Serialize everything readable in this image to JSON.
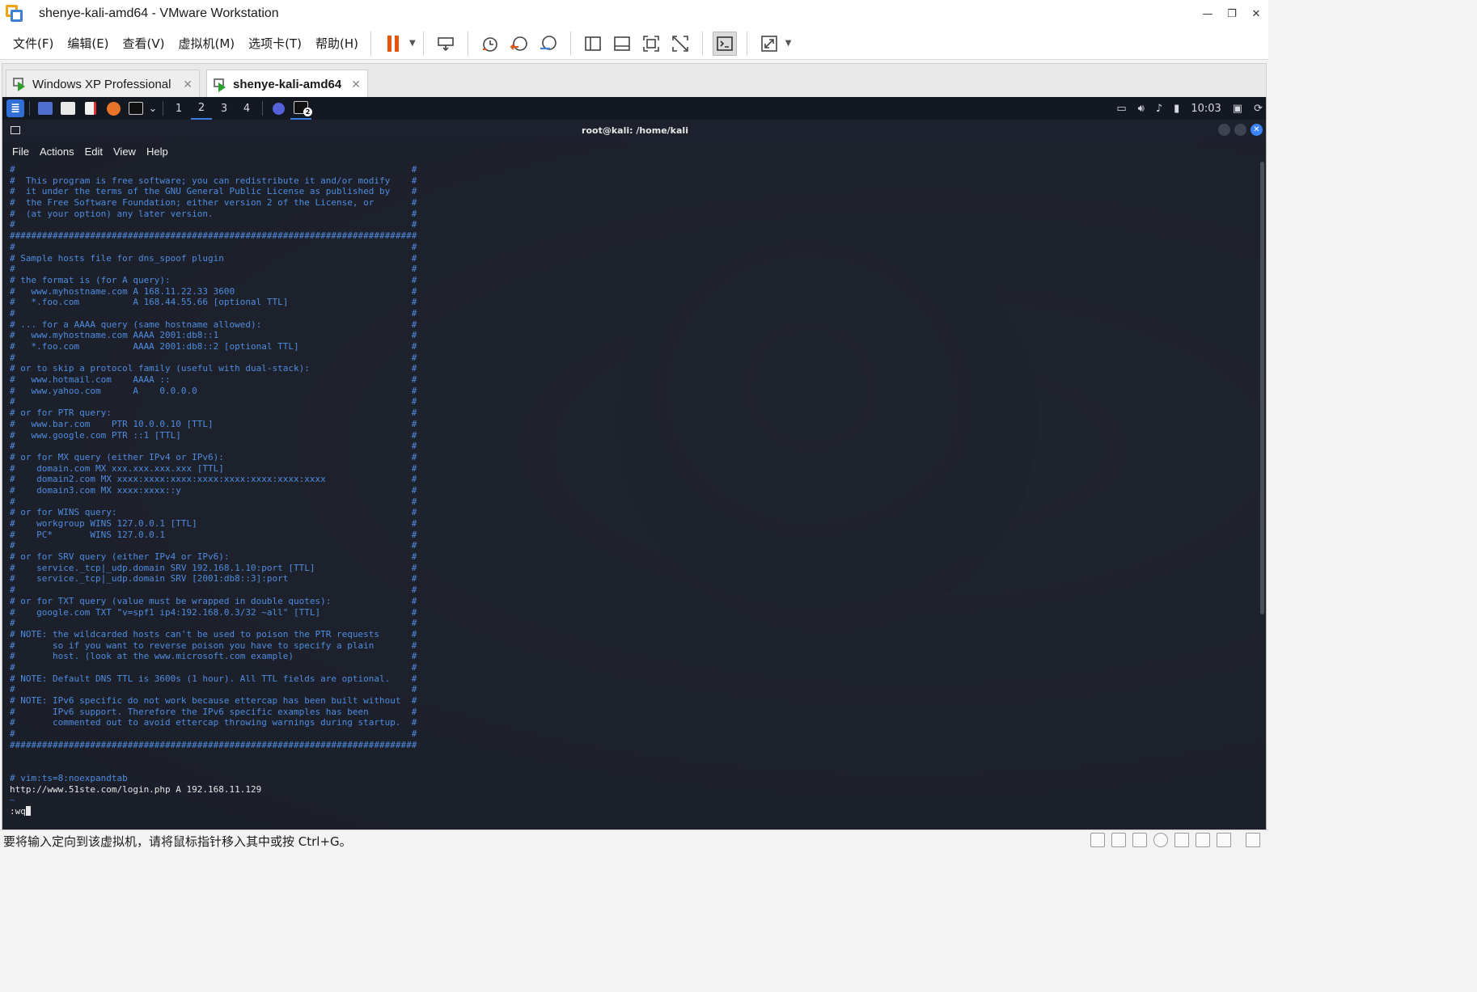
{
  "window": {
    "title": "shenye-kali-amd64 - VMware Workstation"
  },
  "menu": [
    "文件(F)",
    "编辑(E)",
    "查看(V)",
    "虚拟机(M)",
    "选项卡(T)",
    "帮助(H)"
  ],
  "tabs": [
    {
      "label": "Windows XP Professional",
      "active": false
    },
    {
      "label": "shenye-kali-amd64",
      "active": true
    }
  ],
  "guest_panel": {
    "workspaces": [
      "1",
      "2",
      "3",
      "4"
    ],
    "current_workspace": "2",
    "clock": "10:03",
    "terminal_badge": "2"
  },
  "terminal": {
    "title": "root@kali: /home/kali",
    "menu": [
      "File",
      "Actions",
      "Edit",
      "View",
      "Help"
    ],
    "lines": [
      {
        "t": "#                                                                          #",
        "c": "comment"
      },
      {
        "t": "#  This program is free software; you can redistribute it and/or modify    #",
        "c": "comment"
      },
      {
        "t": "#  it under the terms of the GNU General Public License as published by    #",
        "c": "comment"
      },
      {
        "t": "#  the Free Software Foundation; either version 2 of the License, or       #",
        "c": "comment"
      },
      {
        "t": "#  (at your option) any later version.                                     #",
        "c": "comment"
      },
      {
        "t": "#                                                                          #",
        "c": "comment"
      },
      {
        "t": "############################################################################",
        "c": "comment"
      },
      {
        "t": "#                                                                          #",
        "c": "comment"
      },
      {
        "t": "# Sample hosts file for dns_spoof plugin                                   #",
        "c": "comment"
      },
      {
        "t": "#                                                                          #",
        "c": "comment"
      },
      {
        "t": "# the format is (for A query):                                             #",
        "c": "comment"
      },
      {
        "t": "#   www.myhostname.com A 168.11.22.33 3600                                 #",
        "c": "comment"
      },
      {
        "t": "#   *.foo.com          A 168.44.55.66 [optional TTL]                       #",
        "c": "comment"
      },
      {
        "t": "#                                                                          #",
        "c": "comment"
      },
      {
        "t": "# ... for a AAAA query (same hostname allowed):                            #",
        "c": "comment"
      },
      {
        "t": "#   www.myhostname.com AAAA 2001:db8::1                                    #",
        "c": "comment"
      },
      {
        "t": "#   *.foo.com          AAAA 2001:db8::2 [optional TTL]                     #",
        "c": "comment"
      },
      {
        "t": "#                                                                          #",
        "c": "comment"
      },
      {
        "t": "# or to skip a protocol family (useful with dual-stack):                   #",
        "c": "comment"
      },
      {
        "t": "#   www.hotmail.com    AAAA ::                                             #",
        "c": "comment"
      },
      {
        "t": "#   www.yahoo.com      A    0.0.0.0                                        #",
        "c": "comment"
      },
      {
        "t": "#                                                                          #",
        "c": "comment"
      },
      {
        "t": "# or for PTR query:                                                        #",
        "c": "comment"
      },
      {
        "t": "#   www.bar.com    PTR 10.0.0.10 [TTL]                                     #",
        "c": "comment"
      },
      {
        "t": "#   www.google.com PTR ::1 [TTL]                                           #",
        "c": "comment"
      },
      {
        "t": "#                                                                          #",
        "c": "comment"
      },
      {
        "t": "# or for MX query (either IPv4 or IPv6):                                   #",
        "c": "comment"
      },
      {
        "t": "#    domain.com MX xxx.xxx.xxx.xxx [TTL]                                   #",
        "c": "comment"
      },
      {
        "t": "#    domain2.com MX xxxx:xxxx:xxxx:xxxx:xxxx:xxxx:xxxx:xxxx                #",
        "c": "comment"
      },
      {
        "t": "#    domain3.com MX xxxx:xxxx::y                                           #",
        "c": "comment"
      },
      {
        "t": "#                                                                          #",
        "c": "comment"
      },
      {
        "t": "# or for WINS query:                                                       #",
        "c": "comment"
      },
      {
        "t": "#    workgroup WINS 127.0.0.1 [TTL]                                        #",
        "c": "comment"
      },
      {
        "t": "#    PC*       WINS 127.0.0.1                                              #",
        "c": "comment"
      },
      {
        "t": "#                                                                          #",
        "c": "comment"
      },
      {
        "t": "# or for SRV query (either IPv4 or IPv6):                                  #",
        "c": "comment"
      },
      {
        "t": "#    service._tcp|_udp.domain SRV 192.168.1.10:port [TTL]                  #",
        "c": "comment"
      },
      {
        "t": "#    service._tcp|_udp.domain SRV [2001:db8::3]:port                       #",
        "c": "comment"
      },
      {
        "t": "#                                                                          #",
        "c": "comment"
      },
      {
        "t": "# or for TXT query (value must be wrapped in double quotes):               #",
        "c": "comment"
      },
      {
        "t": "#    google.com TXT \"v=spf1 ip4:192.168.0.3/32 ~all\" [TTL]                 #",
        "c": "comment"
      },
      {
        "t": "#                                                                          #",
        "c": "comment"
      },
      {
        "t": "# NOTE: the wildcarded hosts can't be used to poison the PTR requests      #",
        "c": "comment"
      },
      {
        "t": "#       so if you want to reverse poison you have to specify a plain       #",
        "c": "comment"
      },
      {
        "t": "#       host. (look at the www.microsoft.com example)                      #",
        "c": "comment"
      },
      {
        "t": "#                                                                          #",
        "c": "comment"
      },
      {
        "t": "# NOTE: Default DNS TTL is 3600s (1 hour). All TTL fields are optional.    #",
        "c": "comment"
      },
      {
        "t": "#                                                                          #",
        "c": "comment"
      },
      {
        "t": "# NOTE: IPv6 specific do not work because ettercap has been built without  #",
        "c": "comment"
      },
      {
        "t": "#       IPv6 support. Therefore the IPv6 specific examples has been        #",
        "c": "comment"
      },
      {
        "t": "#       commented out to avoid ettercap throwing warnings during startup.  #",
        "c": "comment"
      },
      {
        "t": "#                                                                          #",
        "c": "comment"
      },
      {
        "t": "############################################################################",
        "c": "comment"
      },
      {
        "t": "",
        "c": "comment"
      },
      {
        "t": "",
        "c": "comment"
      },
      {
        "t": "# vim:ts=8:noexpandtab",
        "c": "comment"
      },
      {
        "t": "http://www.51ste.com/login.php A 192.168.11.129",
        "c": "plain"
      },
      {
        "t": "~",
        "c": "tilde"
      }
    ],
    "command_line": ":wq"
  },
  "status_bar": {
    "message": "要将输入定向到该虚拟机，请将鼠标指针移入其中或按 Ctrl+G。"
  },
  "colors": {
    "pause": "#e8540c",
    "accent": "#3b82f6",
    "comment_text": "#4f8ce0"
  }
}
